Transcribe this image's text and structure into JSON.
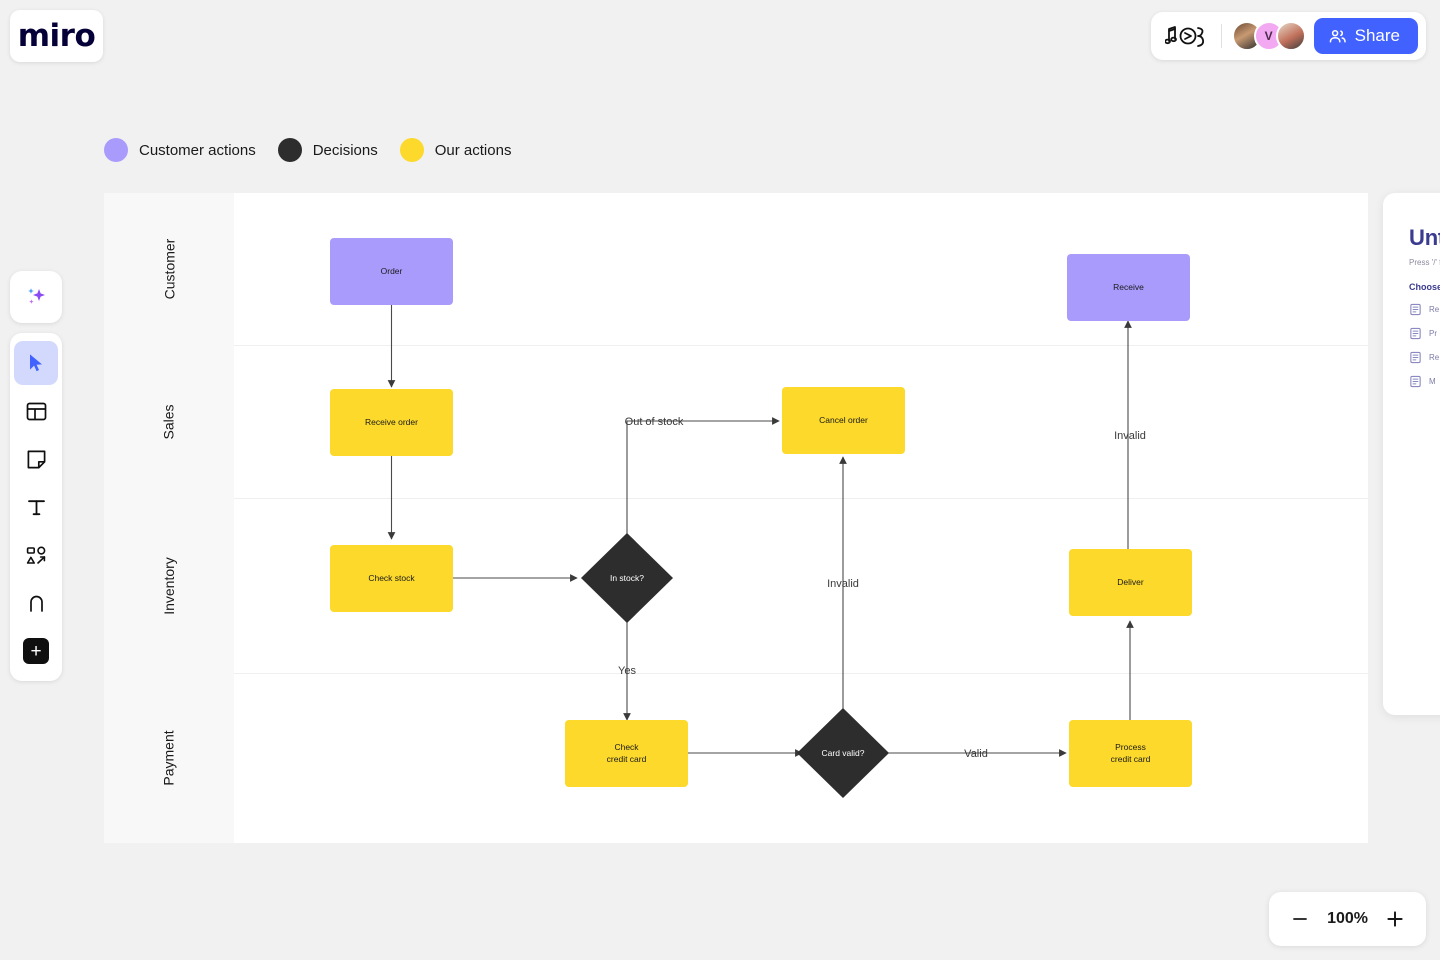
{
  "app": {
    "logo_text": "miro",
    "doodle_icon": "music-note-doodle-icon"
  },
  "header": {
    "share_label": "Share",
    "share_icon": "people-icon",
    "avatars": [
      {
        "name": "avatar-1",
        "initial": ""
      },
      {
        "name": "avatar-2",
        "initial": "V"
      },
      {
        "name": "avatar-3",
        "initial": ""
      }
    ]
  },
  "toolbar": {
    "items": [
      {
        "icon": "ai-sparkles-icon",
        "label": "AI",
        "active": false
      },
      {
        "icon": "cursor-select-icon",
        "label": "Select",
        "active": true
      },
      {
        "icon": "templates-icon",
        "label": "Templates",
        "active": false
      },
      {
        "icon": "sticky-note-icon",
        "label": "Sticky note",
        "active": false
      },
      {
        "icon": "text-icon",
        "label": "Text",
        "active": false
      },
      {
        "icon": "shapes-icon",
        "label": "Shapes",
        "active": false
      },
      {
        "icon": "pen-icon",
        "label": "Pen",
        "active": false
      },
      {
        "icon": "plus-icon",
        "label": "More apps",
        "active": false
      }
    ]
  },
  "legend": {
    "items": [
      {
        "label": "Customer actions",
        "color": "#A99BFC"
      },
      {
        "label": "Decisions",
        "color": "#2D2D2D"
      },
      {
        "label": "Our actions",
        "color": "#FCD92B"
      }
    ]
  },
  "board": {
    "lanes": [
      "Customer",
      "Sales",
      "Inventory",
      "Payment"
    ],
    "nodes": [
      {
        "id": "order",
        "label": "Order",
        "type": "customer",
        "lane": "Customer"
      },
      {
        "id": "receive",
        "label": "Receive",
        "type": "customer",
        "lane": "Customer"
      },
      {
        "id": "receive_order",
        "label": "Receive order",
        "type": "action",
        "lane": "Sales"
      },
      {
        "id": "cancel_order",
        "label": "Cancel order",
        "type": "action",
        "lane": "Sales"
      },
      {
        "id": "check_stock",
        "label": "Check stock",
        "type": "action",
        "lane": "Inventory"
      },
      {
        "id": "in_stock",
        "label": "In stock?",
        "type": "decision",
        "lane": "Inventory"
      },
      {
        "id": "deliver",
        "label": "Deliver",
        "type": "action",
        "lane": "Inventory"
      },
      {
        "id": "check_cc",
        "label": "Check\ncredit card",
        "type": "action",
        "lane": "Payment"
      },
      {
        "id": "card_valid",
        "label": "Card valid?",
        "type": "decision",
        "lane": "Payment"
      },
      {
        "id": "process_cc",
        "label": "Process\ncredit card",
        "type": "action",
        "lane": "Payment"
      }
    ],
    "edges": [
      {
        "from": "order",
        "to": "receive_order",
        "label": ""
      },
      {
        "from": "receive_order",
        "to": "check_stock",
        "label": ""
      },
      {
        "from": "check_stock",
        "to": "in_stock",
        "label": ""
      },
      {
        "from": "in_stock",
        "to": "cancel_order",
        "label": "Out of stock"
      },
      {
        "from": "in_stock",
        "to": "check_cc",
        "label": "Yes"
      },
      {
        "from": "check_cc",
        "to": "card_valid",
        "label": ""
      },
      {
        "from": "card_valid",
        "to": "cancel_order",
        "label": "Invalid"
      },
      {
        "from": "card_valid",
        "to": "process_cc",
        "label": "Valid"
      },
      {
        "from": "process_cc",
        "to": "deliver",
        "label": ""
      },
      {
        "from": "deliver",
        "to": "receive",
        "label": "Invalid"
      }
    ]
  },
  "side_panel": {
    "title": "Unt",
    "hint": "Press '/' f",
    "section_label": "Choose",
    "items": [
      {
        "icon": "document-icon",
        "label": "Re"
      },
      {
        "icon": "document-icon",
        "label": "Pr"
      },
      {
        "icon": "document-icon",
        "label": "Re"
      },
      {
        "icon": "document-icon",
        "label": "M"
      }
    ]
  },
  "zoom": {
    "level": "100%",
    "zoom_out_icon": "minus-icon",
    "zoom_in_icon": "plus-icon"
  },
  "colors": {
    "customer": "#A99BFC",
    "action": "#FCD92B",
    "decision": "#2D2D2D",
    "accent": "#4262FF",
    "canvas": "#F1F1F1"
  }
}
